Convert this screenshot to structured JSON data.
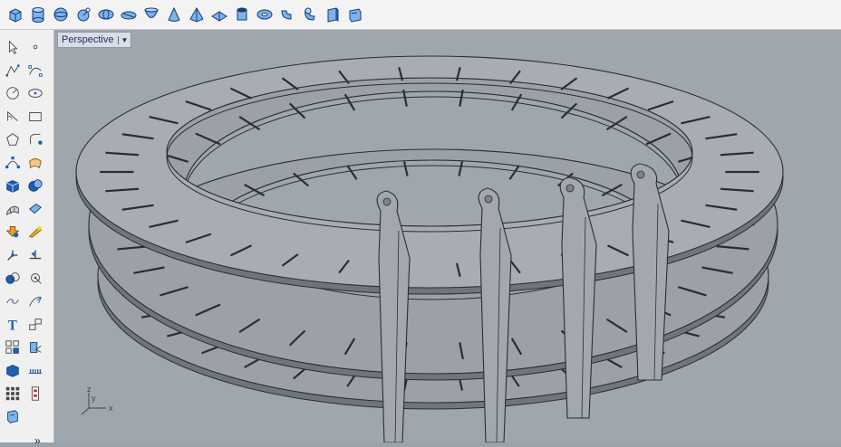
{
  "viewport": {
    "title": "Perspective"
  },
  "axis": {
    "x_label": "x",
    "y_label": "y",
    "z_label": "z"
  },
  "toolbar_top": [
    {
      "name": "box-icon",
      "shape": "box"
    },
    {
      "name": "cylinder-icon",
      "shape": "cylinder"
    },
    {
      "name": "sphere-icon",
      "shape": "sphere"
    },
    {
      "name": "sphere-center-radius-icon",
      "shape": "sphere2"
    },
    {
      "name": "ellipsoid-icon",
      "shape": "ellipsoid"
    },
    {
      "name": "flat-ellipsoid-icon",
      "shape": "ellipsoid2"
    },
    {
      "name": "paraboloid-icon",
      "shape": "paraboloid"
    },
    {
      "name": "cone-icon",
      "shape": "cone"
    },
    {
      "name": "pyramid-icon",
      "shape": "pyramid"
    },
    {
      "name": "truncated-cone-icon",
      "shape": "flatpyr"
    },
    {
      "name": "tube-icon",
      "shape": "tube"
    },
    {
      "name": "torus-icon",
      "shape": "torus"
    },
    {
      "name": "pipe-icon",
      "shape": "pipe"
    },
    {
      "name": "pipe-bend-icon",
      "shape": "pipe2"
    },
    {
      "name": "extrude-solid-icon",
      "shape": "extrude"
    },
    {
      "name": "extrude-curve-icon",
      "shape": "extrude2"
    }
  ],
  "toolbar_left": [
    {
      "name": "select-icon",
      "shape": "arrow"
    },
    {
      "name": "point-icon",
      "shape": "point"
    },
    {
      "name": "polyline-icon",
      "shape": "polyline"
    },
    {
      "name": "curve-icon",
      "shape": "curve"
    },
    {
      "name": "circle-icon",
      "shape": "circle"
    },
    {
      "name": "ellipse-icon",
      "shape": "ellipse"
    },
    {
      "name": "arc-icon",
      "shape": "arc"
    },
    {
      "name": "rectangle-icon",
      "shape": "rect"
    },
    {
      "name": "polygon-icon",
      "shape": "polygon"
    },
    {
      "name": "fillet-curves-icon",
      "shape": "fillet"
    },
    {
      "name": "control-points-icon",
      "shape": "cpoints"
    },
    {
      "name": "surface-from-curves-icon",
      "shape": "surface"
    },
    {
      "name": "solid-box-icon",
      "shape": "solidbox"
    },
    {
      "name": "solid-tools-icon",
      "shape": "solidtools"
    },
    {
      "name": "mesh-icon",
      "shape": "mesh"
    },
    {
      "name": "surface-edit-icon",
      "shape": "surfedit"
    },
    {
      "name": "transform-icon",
      "shape": "transform"
    },
    {
      "name": "analyze-icon",
      "shape": "analyze"
    },
    {
      "name": "move-icon",
      "shape": "move"
    },
    {
      "name": "mirror-icon",
      "shape": "mirror"
    },
    {
      "name": "boolean-icon",
      "shape": "boolean"
    },
    {
      "name": "osnap-icon",
      "shape": "osnap"
    },
    {
      "name": "join-icon",
      "shape": "join"
    },
    {
      "name": "scale-icon",
      "shape": "scale"
    },
    {
      "name": "text-icon",
      "shape": "text"
    },
    {
      "name": "dimension-icon",
      "shape": "dim"
    },
    {
      "name": "group-icon",
      "shape": "group"
    },
    {
      "name": "layer-icon",
      "shape": "layer"
    },
    {
      "name": "render-icon",
      "shape": "render"
    },
    {
      "name": "grid-snap-icon",
      "shape": "gridsnap"
    },
    {
      "name": "array-icon",
      "shape": "array"
    },
    {
      "name": "properties-icon",
      "shape": "props"
    },
    {
      "name": "details-icon",
      "shape": "details"
    }
  ],
  "more_tools_label": "»"
}
